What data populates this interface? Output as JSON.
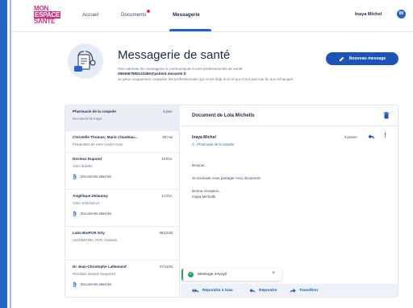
{
  "app": {
    "logo_line1": "MON",
    "logo_line2": "ESPACE",
    "logo_line3": "SANTÉ"
  },
  "nav": {
    "accueil": "Accueil",
    "documents": "Documents",
    "messagerie": "Messagerie"
  },
  "user": {
    "name": "Inaya Michel",
    "initial": "IM"
  },
  "hero": {
    "title": "Messagerie de santé",
    "desc_line1": "Mon adresse de messagerie à communiquer à mes professionnels de santé :",
    "email": "2894567890123456@patient.mssante.fr",
    "desc_line2": "Je peux uniquement contacter les professionnels qui m'ont déjà écrit et qui m'ont pas mis fin aux échanges.",
    "new_message": "Nouveau message"
  },
  "conversations": [
    {
      "name": "Pharmacie de la coupole",
      "date": "3 janv.",
      "sub": "Document de Inaya",
      "attachments": ""
    },
    {
      "name": "Christelle Thomas; Marie Chanteau...",
      "date": "28 mai",
      "sub": "Préparation de votre rendez-vous",
      "attachments": ""
    },
    {
      "name": "Docteur Dupond",
      "date": "15 févr.",
      "sub": "Votre diabète",
      "attachments": "Documents attachés"
    },
    {
      "name": "Angélique Delaunay",
      "date": "14 févr.",
      "sub": "Votre ordonnance",
      "attachments": "Documents attachés"
    },
    {
      "name": "Labo BioPCR Orly",
      "date": "09/12/20",
      "sub": "12234567890, PCR, résultats",
      "attachments": ""
    },
    {
      "name": "Dr Jean-Christophe Lallemand",
      "date": "07/11/20",
      "sub": "Résultats analyse sanguines",
      "attachments": "Documents attachés"
    }
  ],
  "detail": {
    "title": "Document de Lola Michells",
    "sender": "Inaya Michel",
    "recipient": "À : Pharmacie de la coupole",
    "date": "3 janvier",
    "greeting": "Bonjour,",
    "body": "Je souhaite vous partager mon document.",
    "closing": "Bonne réception,",
    "signature": "Inaya Michells"
  },
  "actions": {
    "reply_all": "Répondre à tous",
    "reply": "Répondre",
    "forward": "Transférer"
  },
  "toast": {
    "message": "Message envoyé"
  },
  "colors": {
    "primary": "#1d55b6",
    "accent_pink": "#d2337a",
    "success": "#2e9e5b"
  }
}
